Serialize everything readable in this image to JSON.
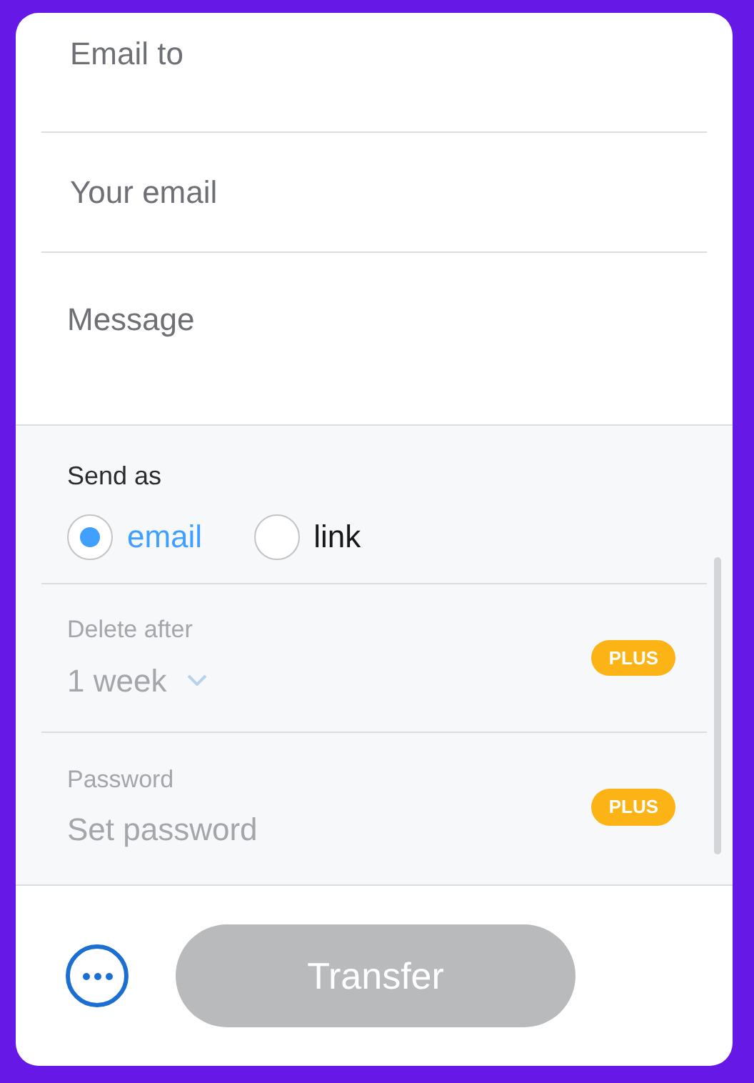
{
  "fields": [
    {
      "placeholder": "Email to",
      "kind": "input"
    },
    {
      "placeholder": "Your email",
      "kind": "input"
    },
    {
      "placeholder": "Message",
      "kind": "textarea"
    }
  ],
  "send_as": {
    "label": "Send as",
    "options": [
      {
        "label": "email",
        "selected": true
      },
      {
        "label": "link",
        "selected": false
      }
    ]
  },
  "settings": [
    {
      "label": "Delete after",
      "value": "1 week",
      "kind": "select",
      "badge": "PLUS",
      "disabled": true
    },
    {
      "label": "Password",
      "placeholder": "Set password",
      "kind": "input",
      "badge": "PLUS",
      "disabled": true
    }
  ],
  "transfer_button": {
    "label": "Transfer",
    "disabled": true
  }
}
